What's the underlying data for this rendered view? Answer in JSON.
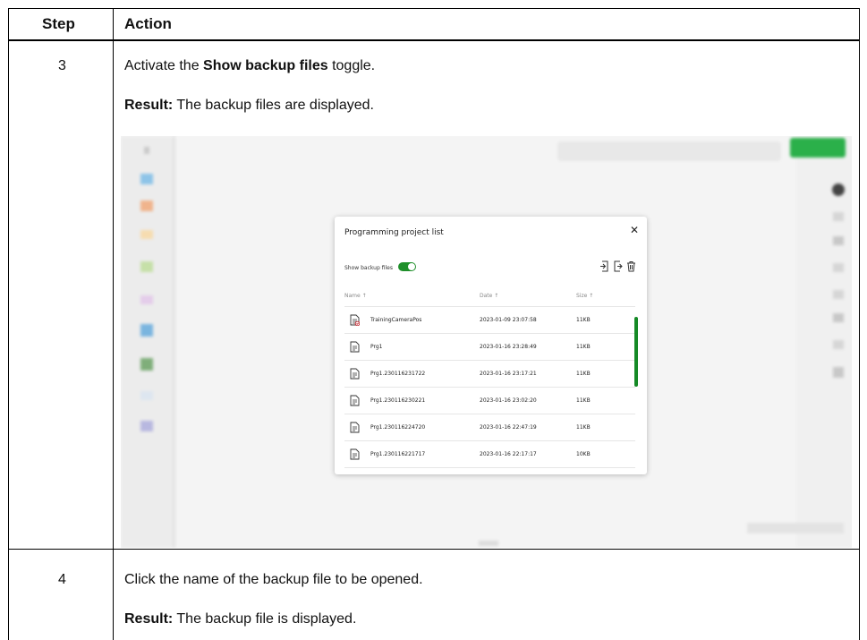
{
  "table": {
    "headers": {
      "step": "Step",
      "action": "Action"
    },
    "rows": [
      {
        "step": "3",
        "instruction_prefix": "Activate the ",
        "instruction_bold": "Show backup files",
        "instruction_suffix": " toggle.",
        "result_label": "Result:",
        "result_text": " The backup files are displayed."
      },
      {
        "step": "4",
        "instruction": "Click the name of the backup file to be opened.",
        "result_label": "Result:",
        "result_text": " The backup file is displayed."
      }
    ]
  },
  "dialog": {
    "title": "Programming project list",
    "close_icon": "close-icon",
    "toggle_label": "Show backup files",
    "toggle_on": true,
    "toggle_color": "#1f8f2a",
    "toolbar_icons": [
      "import-icon",
      "export-icon",
      "trash-icon"
    ],
    "columns": {
      "name": "Name ↑",
      "date": "Date ↑",
      "size": "Size ↑"
    },
    "files": [
      {
        "name": "TrainingCameraPos",
        "date": "2023-01-09 23:07:58",
        "size": "11KB",
        "icon": "file-checked-icon"
      },
      {
        "name": "Prg1",
        "date": "2023-01-16 23:28:49",
        "size": "11KB",
        "icon": "file-icon"
      },
      {
        "name": "Prg1.230116231722",
        "date": "2023-01-16 23:17:21",
        "size": "11KB",
        "icon": "file-icon"
      },
      {
        "name": "Prg1.230116230221",
        "date": "2023-01-16 23:02:20",
        "size": "11KB",
        "icon": "file-icon"
      },
      {
        "name": "Prg1.230116224720",
        "date": "2023-01-16 22:47:19",
        "size": "11KB",
        "icon": "file-icon"
      },
      {
        "name": "Prg1.230116221717",
        "date": "2023-01-16 22:17:17",
        "size": "10KB",
        "icon": "file-icon"
      }
    ],
    "scrollbar_color": "#158a26"
  },
  "background_app": {
    "accent": "#2bb04a"
  }
}
